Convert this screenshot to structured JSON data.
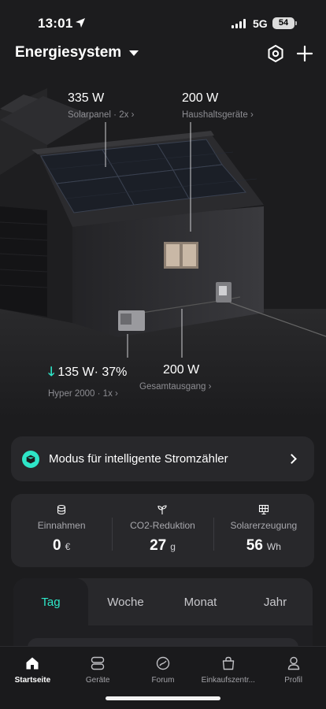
{
  "status": {
    "time": "13:01",
    "network": "5G",
    "battery": "54"
  },
  "header": {
    "title": "Energiesystem"
  },
  "scene": {
    "solar": {
      "value": "335 W",
      "label": "Solarpanel · 2x"
    },
    "household": {
      "value": "200 W",
      "label": "Haushaltsgeräte"
    },
    "battery": {
      "value": "135 W· 37%",
      "label": "Hyper 2000 · 1x"
    },
    "output": {
      "value": "200 W",
      "label": "Gesamtausgang"
    }
  },
  "mode_card": {
    "label": "Modus für intelligente Stromzähler"
  },
  "stats": [
    {
      "label": "Einnahmen",
      "value": "0",
      "unit": "€",
      "icon": "coins-icon"
    },
    {
      "label": "CO2-Reduktion",
      "value": "27",
      "unit": "g",
      "icon": "sprout-icon"
    },
    {
      "label": "Solarerzeugung",
      "value": "56",
      "unit": "Wh",
      "icon": "solar-panel-icon"
    }
  ],
  "tabs": [
    "Tag",
    "Woche",
    "Monat",
    "Jahr"
  ],
  "nav": [
    {
      "label": "Startseite",
      "icon": "home-icon"
    },
    {
      "label": "Geräte",
      "icon": "devices-icon"
    },
    {
      "label": "Forum",
      "icon": "forum-icon"
    },
    {
      "label": "Einkaufszentr...",
      "icon": "shopping-bag-icon"
    },
    {
      "label": "Profil",
      "icon": "profile-icon"
    }
  ],
  "colors": {
    "accent": "#2ee6c8",
    "background": "#1c1c1e",
    "card": "#28282b"
  }
}
